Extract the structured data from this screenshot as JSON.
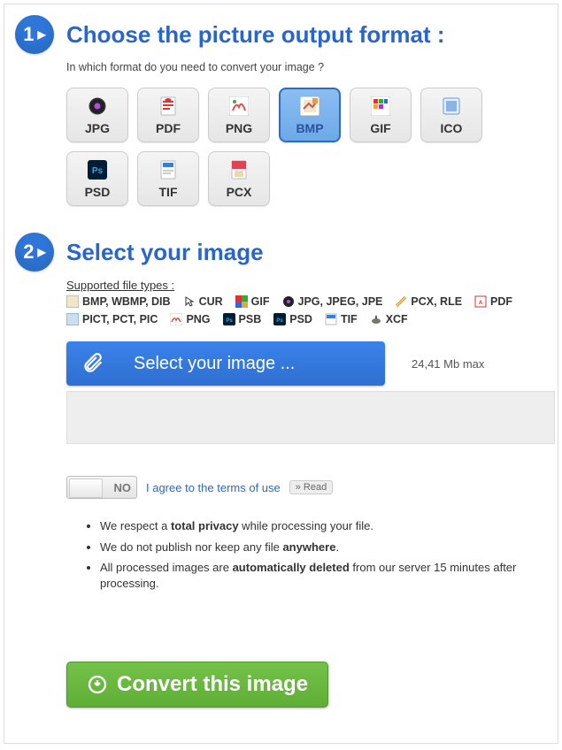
{
  "step1": {
    "badge": "1",
    "title": "Choose the picture output format :",
    "subtitle": "In which format do you need to convert your image ?",
    "formats": [
      {
        "label": "JPG",
        "selected": false
      },
      {
        "label": "PDF",
        "selected": false
      },
      {
        "label": "PNG",
        "selected": false
      },
      {
        "label": "BMP",
        "selected": true
      },
      {
        "label": "GIF",
        "selected": false
      },
      {
        "label": "ICO",
        "selected": false
      },
      {
        "label": "PSD",
        "selected": false
      },
      {
        "label": "TIF",
        "selected": false
      },
      {
        "label": "PCX",
        "selected": false
      }
    ]
  },
  "step2": {
    "badge": "2",
    "title": "Select your image",
    "supported_title": "Supported file types :",
    "supported": [
      "BMP, WBMP, DIB",
      "CUR",
      "GIF",
      "JPG, JPEG, JPE",
      "PCX, RLE",
      "PDF",
      "PICT, PCT, PIC",
      "PNG",
      "PSB",
      "PSD",
      "TIF",
      "XCF"
    ],
    "upload_label": "Select your image ...",
    "max_size": "24,41 Mb max",
    "toggle_value": "NO",
    "terms_text": "I agree to the terms of use",
    "read_label": "» Read",
    "bullets": {
      "b1_pre": "We respect a ",
      "b1_bold": "total privacy",
      "b1_post": " while processing your file.",
      "b2_pre": "We do not publish nor keep any file ",
      "b2_bold": "anywhere",
      "b2_post": ".",
      "b3_pre": "All processed images are ",
      "b3_bold": "automatically deleted",
      "b3_post": " from our server 15 minutes after processing."
    }
  },
  "convert": {
    "label": "Convert this image"
  }
}
